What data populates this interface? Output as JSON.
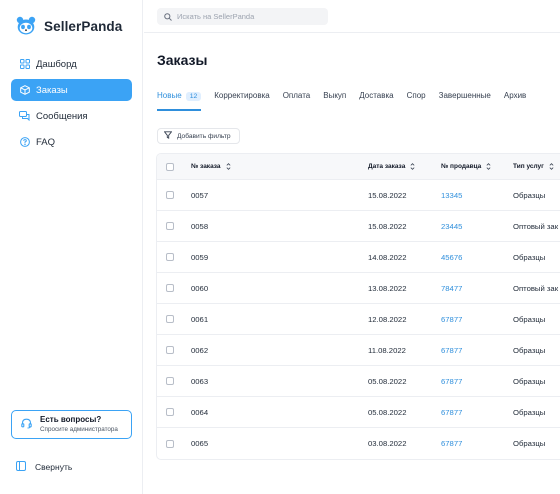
{
  "app": {
    "name": "SellerPanda"
  },
  "search": {
    "placeholder": "Искать на SellerPanda"
  },
  "sidebar": {
    "items": [
      {
        "label": "Дашборд",
        "icon": "grid-icon",
        "active": false
      },
      {
        "label": "Заказы",
        "icon": "box-icon",
        "active": true
      },
      {
        "label": "Сообщения",
        "icon": "chat-icon",
        "active": false
      },
      {
        "label": "FAQ",
        "icon": "question-circle-icon",
        "active": false
      }
    ],
    "help": {
      "title": "Есть вопросы?",
      "subtitle": "Спросите администратора"
    },
    "collapse_label": "Свернуть"
  },
  "page": {
    "title": "Заказы"
  },
  "tabs": [
    {
      "label": "Новые",
      "badge": "12",
      "active": true
    },
    {
      "label": "Корректировка"
    },
    {
      "label": "Оплата"
    },
    {
      "label": "Выкуп"
    },
    {
      "label": "Доставка"
    },
    {
      "label": "Спор"
    },
    {
      "label": "Завершенные"
    },
    {
      "label": "Архив"
    }
  ],
  "filter": {
    "label": "Добавить фильтр"
  },
  "table": {
    "columns": [
      "№ заказа",
      "Дата заказа",
      "№ продавца",
      "Тип услуг"
    ],
    "rows": [
      {
        "order": "0057",
        "date": "15.08.2022",
        "seller": "13345",
        "service": "Образцы"
      },
      {
        "order": "0058",
        "date": "15.08.2022",
        "seller": "23445",
        "service": "Оптовый зак"
      },
      {
        "order": "0059",
        "date": "14.08.2022",
        "seller": "45676",
        "service": "Образцы"
      },
      {
        "order": "0060",
        "date": "13.08.2022",
        "seller": "78477",
        "service": "Оптовый зак"
      },
      {
        "order": "0061",
        "date": "12.08.2022",
        "seller": "67877",
        "service": "Образцы"
      },
      {
        "order": "0062",
        "date": "11.08.2022",
        "seller": "67877",
        "service": "Образцы"
      },
      {
        "order": "0063",
        "date": "05.08.2022",
        "seller": "67877",
        "service": "Образцы"
      },
      {
        "order": "0064",
        "date": "05.08.2022",
        "seller": "67877",
        "service": "Образцы"
      },
      {
        "order": "0065",
        "date": "03.08.2022",
        "seller": "67877",
        "service": "Образцы"
      }
    ]
  },
  "colors": {
    "accent": "#3ba3f5",
    "link": "#2f8fdc",
    "header_bg": "#f7f8fa"
  }
}
